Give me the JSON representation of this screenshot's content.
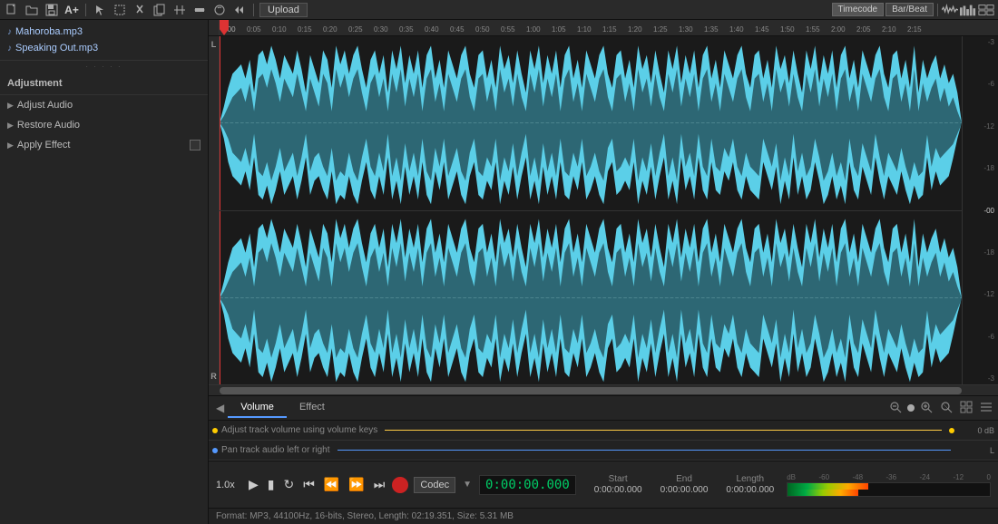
{
  "toolbar": {
    "upload_label": "Upload",
    "timecode_label": "Timecode",
    "barbeat_label": "Bar/Beat"
  },
  "tracks": [
    {
      "name": "Mahoroba.mp3"
    },
    {
      "name": "Speaking Out.mp3"
    }
  ],
  "adjustment": {
    "title": "Adjustment",
    "items": [
      {
        "label": "Adjust Audio"
      },
      {
        "label": "Restore Audio"
      },
      {
        "label": "Apply Effect"
      }
    ]
  },
  "ruler": {
    "marks": [
      "0:00",
      "0:05",
      "0:10",
      "0:15",
      "0:20",
      "0:25",
      "0:30",
      "0:35",
      "0:40",
      "0:45",
      "0:50",
      "0:55",
      "1:00",
      "1:05",
      "1:10",
      "1:15",
      "1:20",
      "1:25",
      "1:30",
      "1:35",
      "1:40",
      "1:45",
      "1:50",
      "1:55",
      "2:00",
      "2:05",
      "2:10",
      "2:15"
    ]
  },
  "channels": {
    "left": "L",
    "right": "R"
  },
  "db_scale": [
    "-3",
    "-6",
    "-12",
    "-18",
    "-00",
    "-18",
    "-12",
    "-6",
    "-3"
  ],
  "tabs": {
    "volume_label": "Volume",
    "effect_label": "Effect"
  },
  "automation": {
    "lane1_label": "Adjust track volume using volume keys",
    "lane2_label": "Pan track audio left or right",
    "db_label": "dB"
  },
  "transport": {
    "speed": "1.0x",
    "time": "0:00:00.000",
    "codec_label": "Codec",
    "start_label": "Start",
    "end_label": "End",
    "length_label": "Length",
    "start_val": "0:00:00.000",
    "end_val": "0:00:00.000",
    "length_val": "0:00:00.000"
  },
  "status": {
    "text": "Format: MP3, 44100Hz, 16-bits, Stereo, Length: 02:19.351, Size: 5.31 MB"
  },
  "db_meter_labels": [
    "-60",
    "-48",
    "-36",
    "-24",
    "-12",
    "0"
  ],
  "colors": {
    "waveform_fill": "#5bcfe8",
    "waveform_dark": "#000",
    "playhead": "#ff4444",
    "accent_blue": "#5599ff"
  }
}
